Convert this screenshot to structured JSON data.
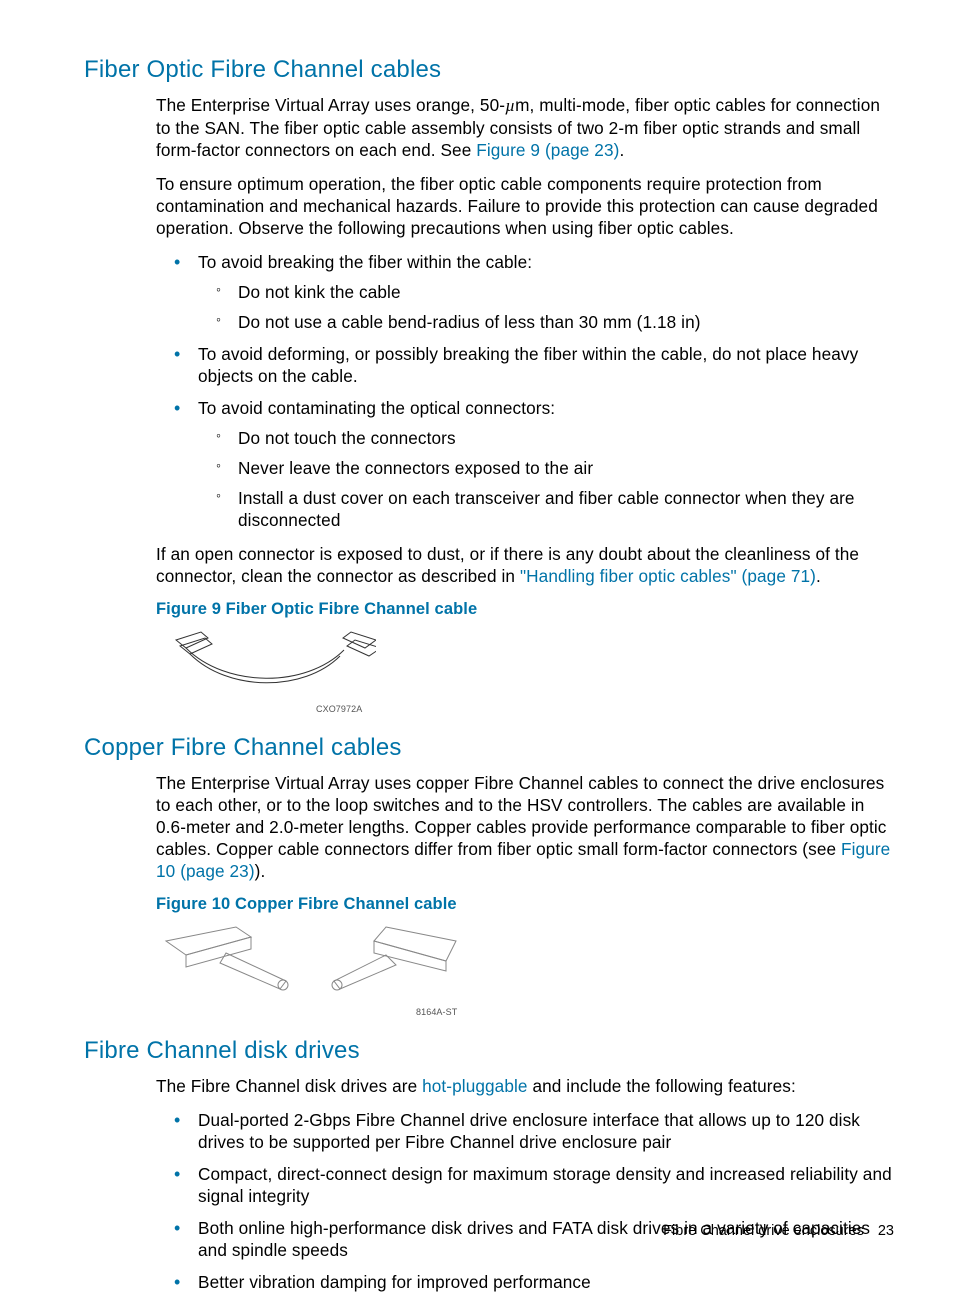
{
  "sections": {
    "s1": {
      "title": "Fiber Optic Fibre Channel cables",
      "p1a": "The Enterprise Virtual Array uses orange, 50-",
      "p1b": "m, multi-mode, fiber optic cables for connection to the SAN. The fiber optic cable assembly consists of two 2-m fiber optic strands and small form-factor connectors on each end. See ",
      "p1link": "Figure 9 (page 23)",
      "p1c": ".",
      "p2": "To ensure optimum operation, the fiber optic cable components require protection from contamination and mechanical hazards. Failure to provide this protection can cause degraded operation. Observe the following precautions when using fiber optic cables.",
      "b1": "To avoid breaking the fiber within the cable:",
      "b1a": "Do not kink the cable",
      "b1b": "Do not use a cable bend-radius of less than 30 mm (1.18 in)",
      "b2": "To avoid deforming, or possibly breaking the fiber within the cable, do not place heavy objects on the cable.",
      "b3": "To avoid contaminating the optical connectors:",
      "b3a": "Do not touch the connectors",
      "b3b": "Never leave the connectors exposed to the air",
      "b3c": "Install a dust cover on each transceiver and fiber cable connector when they are disconnected",
      "p3a": "If an open connector is exposed to dust, or if there is any doubt about the cleanliness of the connector, clean the connector as described in ",
      "p3link": "\"Handling fiber optic cables\" (page 71)",
      "p3b": ".",
      "fig9": "Figure 9 Fiber Optic Fibre Channel cable",
      "fig9label": "CXO7972A"
    },
    "s2": {
      "title": "Copper Fibre Channel cables",
      "p1a": "The Enterprise Virtual Array uses copper Fibre Channel cables to connect the drive enclosures to each other, or to the loop switches and to the HSV controllers. The cables are available in 0.6-meter and 2.0-meter lengths. Copper cables provide performance comparable to fiber optic cables. Copper cable connectors differ from fiber optic small form-factor connectors (see ",
      "p1link": "Figure 10 (page 23)",
      "p1b": ").",
      "fig10": "Figure 10 Copper Fibre Channel cable",
      "fig10label": "8164A-ST"
    },
    "s3": {
      "title": "Fibre Channel disk drives",
      "p1a": "The Fibre Channel disk drives are ",
      "p1link": "hot-pluggable",
      "p1b": " and include the following features:",
      "b1": "Dual-ported 2-Gbps Fibre Channel drive enclosure interface that allows up to 120 disk drives to be supported per Fibre Channel drive enclosure pair",
      "b2": "Compact, direct-connect design for maximum storage density and increased reliability and signal integrity",
      "b3": "Both online high-performance disk drives and FATA disk drives in a variety of capacities and spindle speeds",
      "b4": "Better vibration damping for improved performance"
    }
  },
  "footer": {
    "text": "Fibre Channel drive enclosures",
    "page": "23"
  }
}
